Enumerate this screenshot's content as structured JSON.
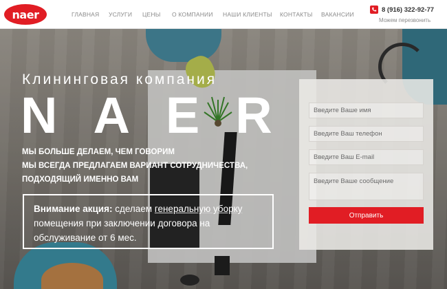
{
  "header": {
    "logo_text": "naer",
    "nav": [
      "ГЛАВНАЯ",
      "УСЛУГИ",
      "ЦЕНЫ",
      "О КОМПАНИИ",
      "НАШИ КЛИЕНТЫ",
      "КОНТАКТЫ",
      "ВАКАНСИИ"
    ],
    "phone": "8 (916) 322-92-77",
    "callback": "Можем перезвонить"
  },
  "hero": {
    "title": "Клининговая компания",
    "brand": "NAER",
    "slogan_lines": [
      "МЫ БОЛЬШЕ ДЕЛАЕМ, ЧЕМ ГОВОРИМ",
      "МЫ ВСЕГДА ПРЕДЛАГАЕМ ВАРИАНТ СОТРУДНИЧЕСТВА,",
      "ПОДХОДЯЩИЙ ИМЕННО ВАМ"
    ],
    "promo": {
      "label": "Внимание акция:",
      "text_before": " сделаем ",
      "link": "генеральную уборку",
      "text_after": " помещения при заключении договора на обслуживание от 6 мес."
    }
  },
  "form": {
    "name_placeholder": "Введите Ваше имя",
    "phone_placeholder": "Введите Ваш телефон",
    "email_placeholder": "Введите Ваш E-mail",
    "message_placeholder": "Введите Ваше сообщение",
    "submit_label": "Отправить"
  },
  "colors": {
    "accent": "#e11d24",
    "header_bg": "#ffffff",
    "nav_text": "#8a8a8a"
  },
  "icons": {
    "phone": "phone-icon"
  }
}
